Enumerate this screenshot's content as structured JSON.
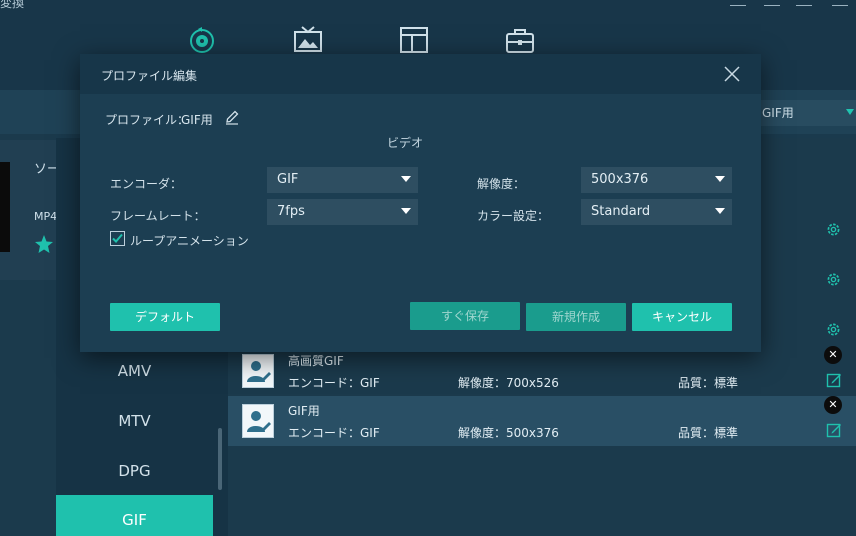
{
  "app": {
    "title": "変換"
  },
  "subbar": {
    "profile_select": "GIF用"
  },
  "left_panel": {
    "heading": "ソー",
    "format": "MP4"
  },
  "formats": [
    {
      "label": "AMV",
      "active": false
    },
    {
      "label": "MTV",
      "active": false
    },
    {
      "label": "DPG",
      "active": false
    },
    {
      "label": "GIF",
      "active": true
    }
  ],
  "profiles": [
    {
      "name": "高画質GIF",
      "encode": "エンコード：GIF",
      "resolution": "解像度：700x526",
      "quality": "品質：標準",
      "selected": false
    },
    {
      "name": "GIF用",
      "encode": "エンコード：GIF",
      "resolution": "解像度：500x376",
      "quality": "品質：標準",
      "selected": true
    }
  ],
  "modal": {
    "title": "プロファイル編集",
    "profile_label": "プロファイル：",
    "profile_name": "GIF用",
    "section": "ビデオ",
    "encoder_label": "エンコーダ：",
    "encoder_value": "GIF",
    "framerate_label": "フレームレート：",
    "framerate_value": "7fps",
    "resolution_label": "解像度：",
    "resolution_value": "500x376",
    "color_label": "カラー設定：",
    "color_value": "Standard",
    "loop_label": "ループアニメーション",
    "loop_checked": true,
    "default_button": "デフォルト",
    "save_button": "すぐ保存",
    "new_button": "新規作成",
    "cancel_button": "キャンセル"
  },
  "colors": {
    "accent": "#1fc1ad",
    "panel": "#1c3e52",
    "background": "#1a3a4d"
  }
}
